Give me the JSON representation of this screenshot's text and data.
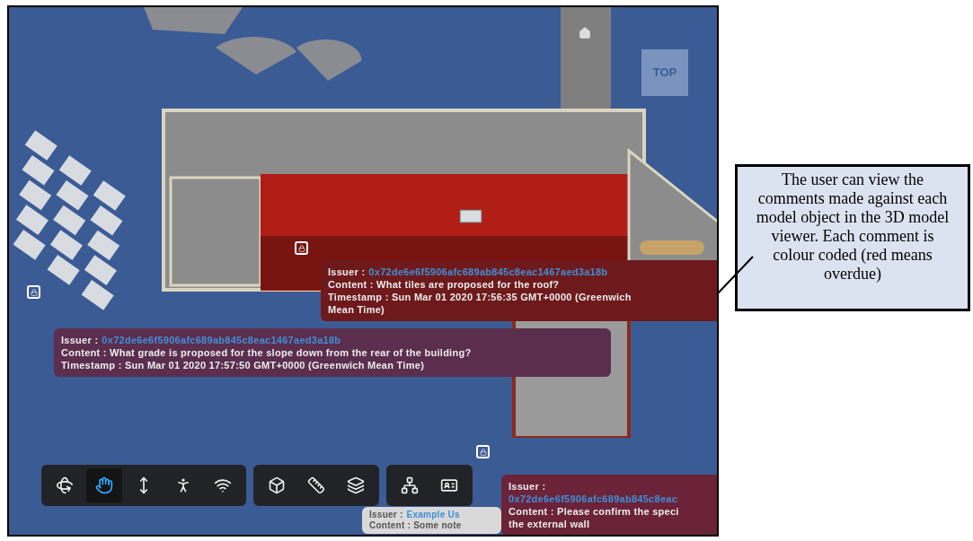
{
  "viewer": {
    "view_cube": {
      "label": "TOP"
    },
    "comments": [
      {
        "issuer_label": "Issuer :",
        "issuer": "0x72de6e6f5906afc689ab845c8eac1467aed3a18b",
        "content": [
          "Content : What tiles are proposed for the roof?"
        ],
        "timestamp": [
          "Timestamp : Sun Mar 01 2020 17:56:35 GMT+0000 (Greenwich",
          "Mean Time)"
        ],
        "color": "#6e1a1c"
      },
      {
        "issuer_label": "Issuer :",
        "issuer": "0x72de6e6f5906afc689ab845c8eac1467aed3a18b",
        "content": [
          "Content : What grade is proposed for the slope down from the rear of the building?"
        ],
        "timestamp": [
          "Timestamp : Sun Mar 01 2020 17:57:50 GMT+0000 (Greenwich Mean Time)"
        ],
        "color": "#5b2e4e"
      },
      {
        "issuer_label": "Issuer :",
        "issuer": "Example Us",
        "content": [
          "Content : Some note"
        ],
        "color": "#d9d9d9"
      },
      {
        "issuer_label": "Issuer :",
        "issuer": "0x72de6e6f5906afc689ab845c8eac",
        "content": [
          "Content : Please confirm the speci",
          "the external wall"
        ],
        "color": "#6a2338"
      }
    ],
    "toolbar": [
      {
        "tools": [
          {
            "kind": "orbit",
            "selected": false
          },
          {
            "kind": "pan",
            "selected": true
          },
          {
            "kind": "zoom",
            "selected": false
          },
          {
            "kind": "walk",
            "selected": false
          },
          {
            "kind": "camera",
            "selected": false
          }
        ]
      },
      {
        "tools": [
          {
            "kind": "section",
            "selected": false
          },
          {
            "kind": "measure",
            "selected": false
          },
          {
            "kind": "explode",
            "selected": false
          }
        ]
      },
      {
        "tools": [
          {
            "kind": "tree",
            "selected": false
          },
          {
            "kind": "properties",
            "selected": false
          }
        ]
      }
    ]
  },
  "callout": {
    "text": "The user can view the comments made against each model object in the 3D model viewer. Each comment is colour coded (red means overdue)"
  }
}
